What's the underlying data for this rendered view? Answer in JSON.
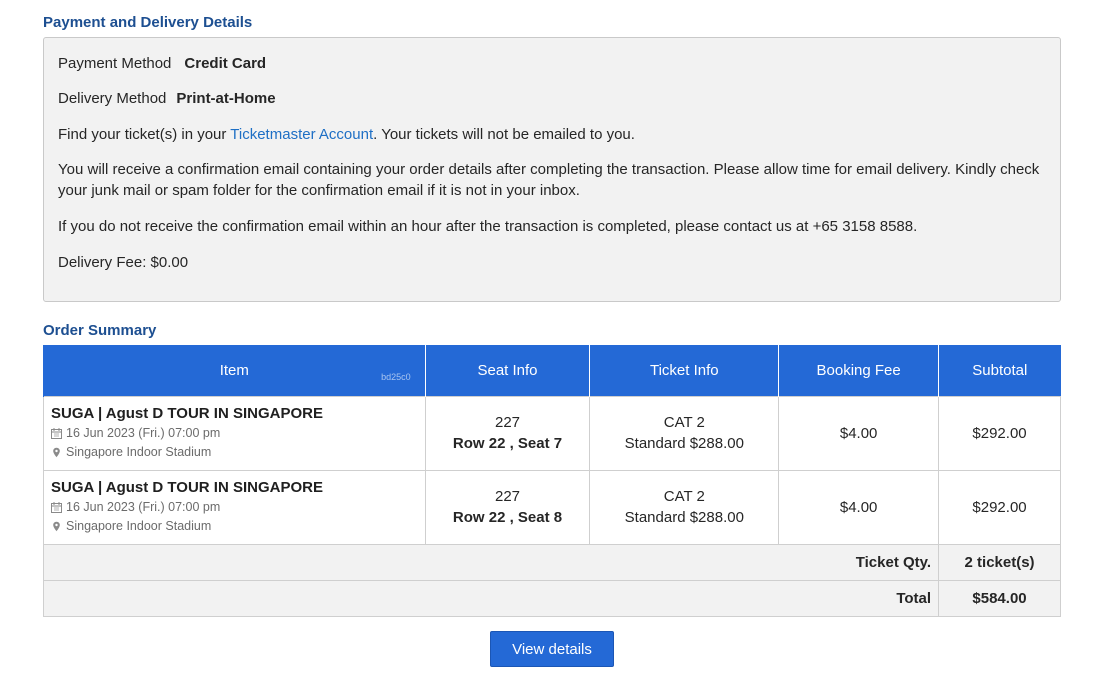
{
  "payment_delivery": {
    "title": "Payment and Delivery Details",
    "payment_label": "Payment Method",
    "payment_value": "Credit Card",
    "delivery_label": "Delivery Method",
    "delivery_value": "Print-at-Home",
    "find_prefix": "Find your ticket(s) in your ",
    "account_link": "Ticketmaster Account",
    "find_suffix": ". Your tickets will not be emailed to you.",
    "confirmation_text": "You will receive a confirmation email containing your order details after completing the transaction. Please allow time for email delivery. Kindly check your junk mail or spam folder for the confirmation email if it is not in your inbox.",
    "contact_text": "If you do not receive the confirmation email within an hour after the transaction is completed, please contact us at +65 3158 8588.",
    "delivery_fee": "Delivery Fee: $0.00"
  },
  "order_summary": {
    "title": "Order Summary",
    "columns": [
      "Item",
      "Seat Info",
      "Ticket Info",
      "Booking Fee",
      "Subtotal"
    ],
    "header_hash": "bd25c0",
    "rows": [
      {
        "event": "SUGA | Agust D TOUR IN SINGAPORE",
        "date": "16 Jun 2023 (Fri.) 07:00 pm",
        "venue": "Singapore Indoor Stadium",
        "section": "227",
        "seat": "Row 22 , Seat 7",
        "category": "CAT 2",
        "ticket_type": "Standard $288.00",
        "booking_fee": "$4.00",
        "subtotal": "$292.00"
      },
      {
        "event": "SUGA | Agust D TOUR IN SINGAPORE",
        "date": "16 Jun 2023 (Fri.) 07:00 pm",
        "venue": "Singapore Indoor Stadium",
        "section": "227",
        "seat": "Row 22 , Seat 8",
        "category": "CAT 2",
        "ticket_type": "Standard $288.00",
        "booking_fee": "$4.00",
        "subtotal": "$292.00"
      }
    ],
    "qty_label": "Ticket Qty.",
    "qty_value": "2 ticket(s)",
    "total_label": "Total",
    "total_value": "$584.00"
  },
  "view_details_label": "View details",
  "icons": {
    "date": "calendar-icon",
    "venue": "location-pin-icon"
  }
}
